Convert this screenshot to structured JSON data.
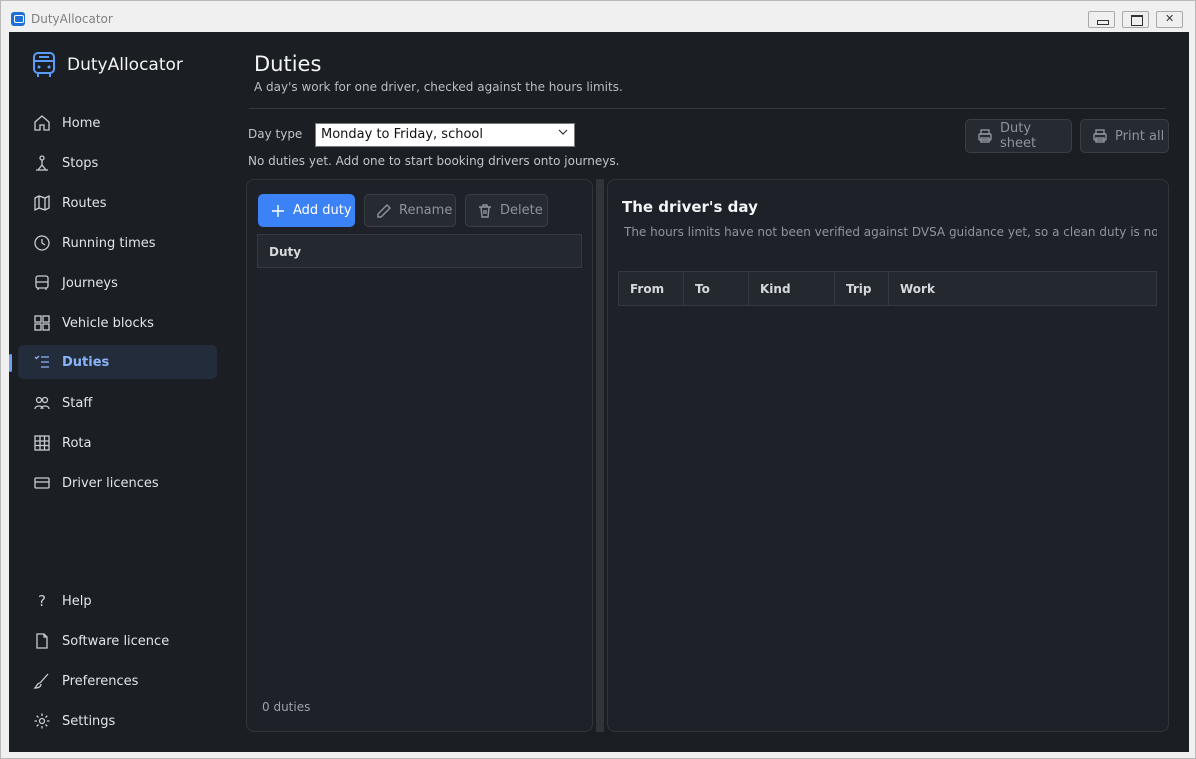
{
  "window": {
    "title": "DutyAllocator"
  },
  "brand": {
    "name": "DutyAllocator",
    "icon": "bus-icon"
  },
  "sidebar": {
    "items": [
      {
        "label": "Home",
        "icon": "home-icon"
      },
      {
        "label": "Stops",
        "icon": "stop-icon"
      },
      {
        "label": "Routes",
        "icon": "map-icon"
      },
      {
        "label": "Running times",
        "icon": "clock-icon"
      },
      {
        "label": "Journeys",
        "icon": "bus-icon"
      },
      {
        "label": "Vehicle blocks",
        "icon": "grid-icon"
      },
      {
        "label": "Duties",
        "icon": "checklist-icon",
        "active": true
      },
      {
        "label": "Staff",
        "icon": "people-icon"
      },
      {
        "label": "Rota",
        "icon": "table-icon"
      },
      {
        "label": "Driver licences",
        "icon": "card-icon"
      }
    ],
    "bottom_items": [
      {
        "label": "Help",
        "icon": "question-icon"
      },
      {
        "label": "Software licence",
        "icon": "document-icon"
      },
      {
        "label": "Preferences",
        "icon": "brush-icon"
      },
      {
        "label": "Settings",
        "icon": "gear-icon"
      }
    ]
  },
  "page": {
    "title": "Duties",
    "subtitle": "A day's work for one driver, checked against the hours limits.",
    "day_type_label": "Day type",
    "day_type_value": "Monday to Friday, school",
    "info": "No duties yet. Add one to start booking drivers onto journeys.",
    "duty_sheet_label": "Duty sheet",
    "print_all_label": "Print all"
  },
  "duties_panel": {
    "add_label": "Add duty",
    "rename_label": "Rename",
    "delete_label": "Delete",
    "column_header": "Duty",
    "count": "0 duties"
  },
  "drivers_day": {
    "title": "The driver's day",
    "note": "The hours limits have not been verified against DVSA guidance yet, so a clean duty is not proof it is legal.",
    "columns": [
      "From",
      "To",
      "Kind",
      "Trip",
      "Work"
    ]
  },
  "colors": {
    "accent": "#3b82f6",
    "active_text": "#8ab4f8",
    "background": "#1b1e23"
  }
}
